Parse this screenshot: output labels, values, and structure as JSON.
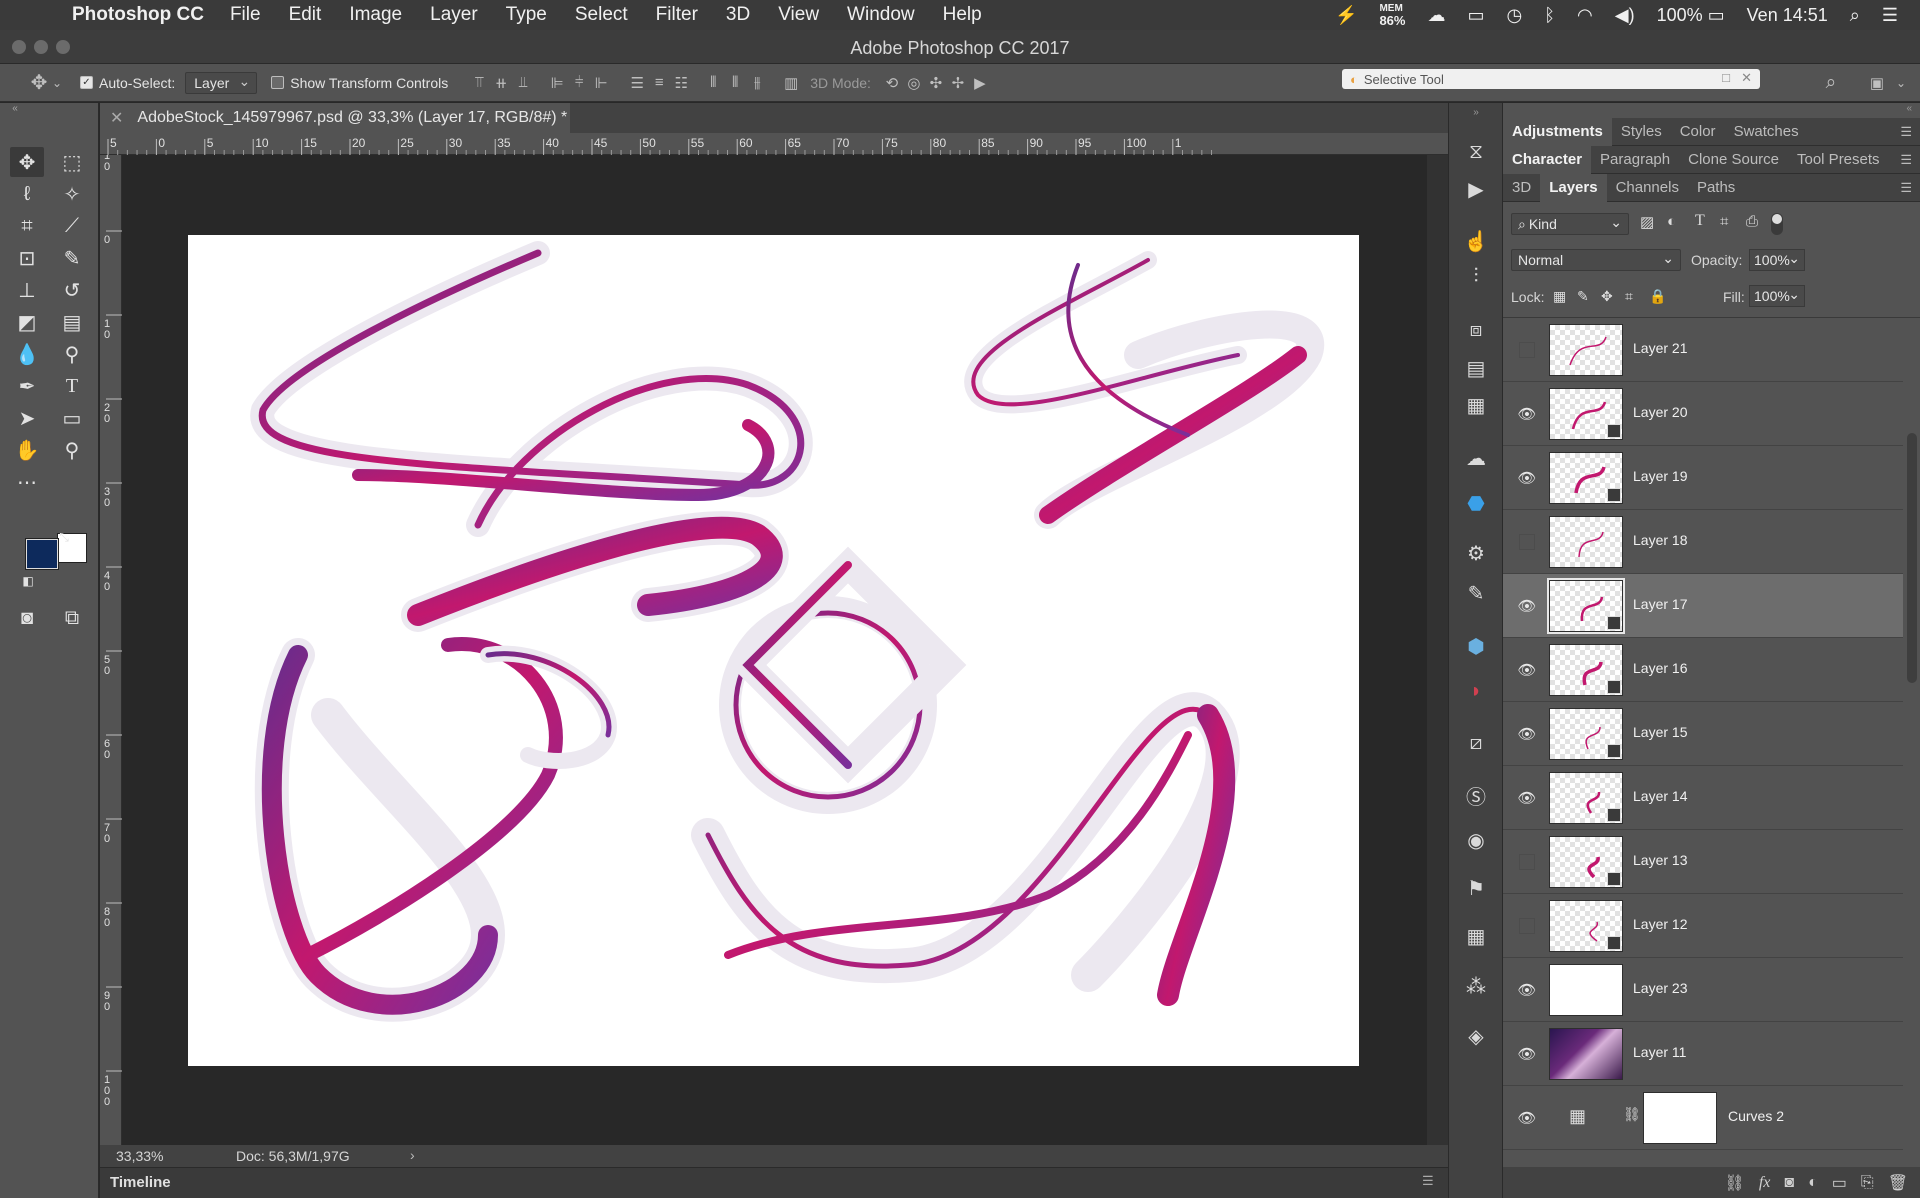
{
  "menubar": {
    "app_name": "Photoshop CC",
    "items": [
      "File",
      "Edit",
      "Image",
      "Layer",
      "Type",
      "Select",
      "Filter",
      "3D",
      "View",
      "Window",
      "Help"
    ],
    "mem_label": "MEM",
    "mem_value": "86%",
    "battery": "100%",
    "clock": "Ven 14:51"
  },
  "window": {
    "title": "Adobe Photoshop CC 2017"
  },
  "options": {
    "auto_select_label": "Auto-Select:",
    "auto_select_value": "Layer",
    "show_transform_label": "Show Transform Controls",
    "mode_label": "3D Mode:",
    "selective_tool": "Selective Tool"
  },
  "document": {
    "tab_title": "AdobeStock_145979967.psd @ 33,3% (Layer 17, RGB/8#) *",
    "ruler_h_labels": [
      "5",
      "0",
      "5",
      "10",
      "15",
      "20",
      "25",
      "30",
      "35",
      "40",
      "45",
      "50",
      "55",
      "60",
      "65",
      "70",
      "75",
      "80",
      "85",
      "90",
      "95",
      "100",
      "1"
    ],
    "ruler_v_labels": [
      "1 0",
      "0",
      "1 0",
      "2 0",
      "3 0",
      "4 0",
      "5 0",
      "6 0",
      "7 0",
      "8 0",
      "9 0",
      "1 0 0"
    ],
    "zoom": "33,33%",
    "doc_info": "Doc: 56,3M/1,97G",
    "timeline_label": "Timeline"
  },
  "panels": {
    "row1": [
      "Adjustments",
      "Styles",
      "Color",
      "Swatches"
    ],
    "row2": [
      "Character",
      "Paragraph",
      "Clone Source",
      "Tool Presets"
    ],
    "row3": [
      "3D",
      "Layers",
      "Channels",
      "Paths"
    ],
    "kind_label": "Kind",
    "blend_mode": "Normal",
    "opacity_label": "Opacity:",
    "opacity_value": "100%",
    "lock_label": "Lock:",
    "fill_label": "Fill:",
    "fill_value": "100%"
  },
  "layers": [
    {
      "name": "Layer 21",
      "visible": false,
      "thumb": "checker",
      "smart": false
    },
    {
      "name": "Layer 20",
      "visible": true,
      "thumb": "checker",
      "smart": true
    },
    {
      "name": "Layer 19",
      "visible": true,
      "thumb": "checker",
      "smart": true
    },
    {
      "name": "Layer 18",
      "visible": false,
      "thumb": "checker",
      "smart": false
    },
    {
      "name": "Layer 17",
      "visible": true,
      "thumb": "checker",
      "smart": true,
      "selected": true
    },
    {
      "name": "Layer 16",
      "visible": true,
      "thumb": "checker",
      "smart": true
    },
    {
      "name": "Layer 15",
      "visible": true,
      "thumb": "checker",
      "smart": true
    },
    {
      "name": "Layer 14",
      "visible": true,
      "thumb": "checker",
      "smart": true
    },
    {
      "name": "Layer 13",
      "visible": false,
      "thumb": "checker",
      "smart": true
    },
    {
      "name": "Layer 12",
      "visible": false,
      "thumb": "checker",
      "smart": true
    },
    {
      "name": "Layer 23",
      "visible": true,
      "thumb": "white",
      "smart": false
    },
    {
      "name": "Layer 11",
      "visible": true,
      "thumb": "photo",
      "smart": false
    },
    {
      "name": "Curves 2",
      "visible": true,
      "thumb": "adjustment",
      "smart": false
    }
  ],
  "colors": {
    "foreground": "#0d2a5c",
    "background": "#ffffff",
    "accent_stroke": "#c2186e",
    "accent_violet": "#6a2c8c"
  }
}
